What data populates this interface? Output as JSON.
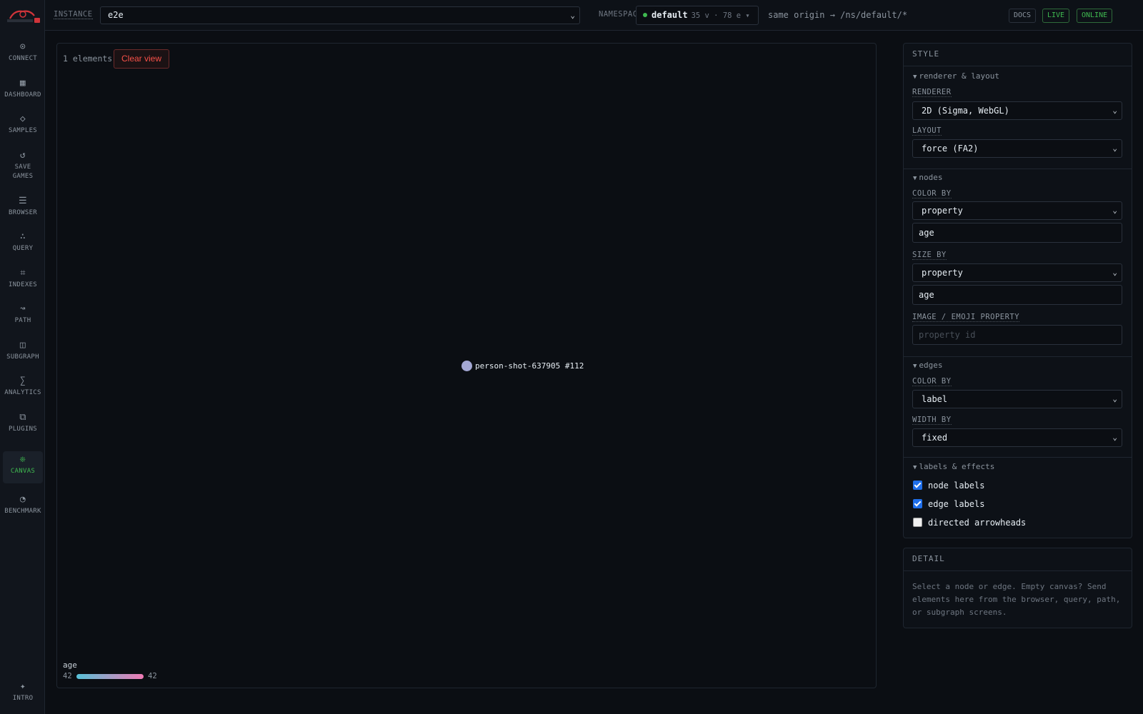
{
  "sidebar": {
    "items": [
      {
        "label": "CONNECT",
        "icon": "connect-icon",
        "glyph": "⊙"
      },
      {
        "label": "DASHBOARD",
        "icon": "dashboard-icon",
        "glyph": "▦"
      },
      {
        "label": "SAMPLES",
        "icon": "samples-icon",
        "glyph": "◇"
      },
      {
        "label": "SAVE GAMES",
        "icon": "save-games-icon",
        "glyph": "↺"
      },
      {
        "label": "BROWSER",
        "icon": "browser-icon",
        "glyph": "☰"
      },
      {
        "label": "QUERY",
        "icon": "query-icon",
        "glyph": "∴"
      },
      {
        "label": "INDEXES",
        "icon": "indexes-icon",
        "glyph": "⌗"
      },
      {
        "label": "PATH",
        "icon": "path-icon",
        "glyph": "↝"
      },
      {
        "label": "SUBGRAPH",
        "icon": "subgraph-icon",
        "glyph": "◫"
      },
      {
        "label": "ANALYTICS",
        "icon": "analytics-icon",
        "glyph": "∑"
      },
      {
        "label": "PLUGINS",
        "icon": "plugins-icon",
        "glyph": "⧉"
      },
      {
        "label": "CANVAS",
        "icon": "canvas-icon",
        "glyph": "❊"
      },
      {
        "label": "BENCHMARK",
        "icon": "benchmark-icon",
        "glyph": "◔"
      }
    ],
    "intro": {
      "label": "INTRO",
      "icon": "intro-icon",
      "glyph": "✦"
    }
  },
  "topbar": {
    "instance_label": "INSTANCE",
    "instance_value": "e2e",
    "namespace_label": "NAMESPACE",
    "namespace_name": "default",
    "namespace_stats": "35 v · 78 e ▾",
    "origin": "same origin → /ns/default/*",
    "docs": "DOCS",
    "live": "LIVE",
    "online": "ONLINE"
  },
  "canvas": {
    "element_count": "1 elements",
    "clear_button": "Clear view",
    "node_label": "person-shot-637905 #112",
    "node_color": "#a4a8d4",
    "legend": {
      "title": "age",
      "min": "42",
      "max": "42"
    }
  },
  "style": {
    "title": "STYLE",
    "renderer_section": "renderer & layout",
    "renderer_label": "RENDERER",
    "renderer_value": "2D (Sigma, WebGL)",
    "layout_label": "LAYOUT",
    "layout_value": "force (FA2)",
    "nodes_section": "nodes",
    "node_color_label": "COLOR BY",
    "node_color_value": "property",
    "node_color_property": "age",
    "size_label": "SIZE BY",
    "size_value": "property",
    "size_property": "age",
    "image_label": "IMAGE / EMOJI PROPERTY",
    "image_placeholder": "property id",
    "edges_section": "edges",
    "edge_color_label": "COLOR BY",
    "edge_color_value": "label",
    "width_label": "WIDTH BY",
    "width_value": "fixed",
    "labels_section": "labels & effects",
    "node_labels": "node labels",
    "edge_labels": "edge labels",
    "arrowheads": "directed arrowheads"
  },
  "detail": {
    "title": "DETAIL",
    "text": "Select a node or edge. Empty canvas? Send elements here from the browser, query, path, or subgraph screens."
  }
}
